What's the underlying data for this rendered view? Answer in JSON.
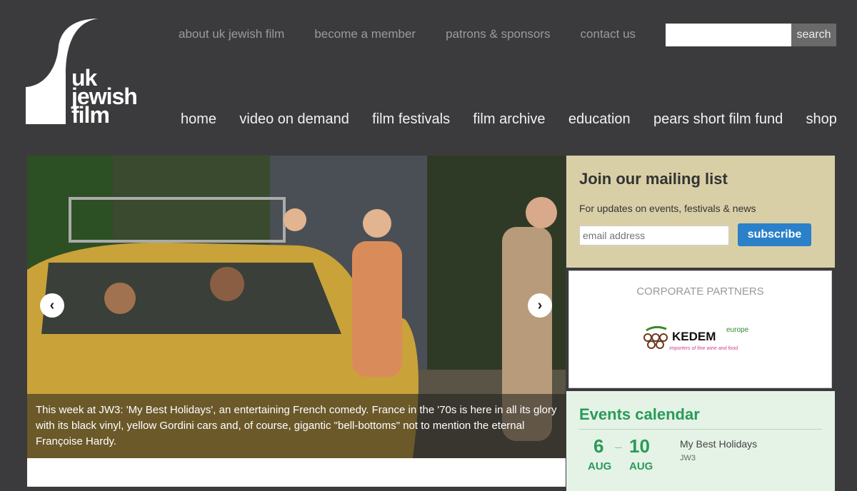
{
  "logo": {
    "line1": "uk",
    "line2": "jewish",
    "line3": "film"
  },
  "topnav": [
    "about uk jewish film",
    "become a member",
    "patrons & sponsors",
    "contact us"
  ],
  "search": {
    "button": "search",
    "placeholder": ""
  },
  "mainnav": [
    "home",
    "video on demand",
    "film festivals",
    "film archive",
    "education",
    "pears short film fund",
    "shop"
  ],
  "hero": {
    "prev": "‹",
    "next": "›",
    "caption": "This week at JW3: 'My Best Holidays', an entertaining French comedy. France in the '70s is here in all its glory with its black vinyl, yellow Gordini cars and, of course, gigantic \"bell-bottoms\" not to mention the eternal Françoise Hardy."
  },
  "mailing": {
    "title": "Join our mailing list",
    "subtitle": "For updates on events, festivals & news",
    "email_placeholder": "email address",
    "subscribe": "subscribe"
  },
  "partners": {
    "heading": "CORPORATE PARTNERS",
    "logo_name": "KEDEM",
    "logo_suffix": "europe",
    "logo_tagline": "Importers of fine wine and food"
  },
  "events": {
    "title": "Events calendar",
    "start_day": "6",
    "start_month": "AUG",
    "end_day": "10",
    "end_month": "AUG",
    "name": "My Best Holidays",
    "venue": "JW3"
  },
  "colors": {
    "background": "#3b3b3d",
    "accent_blue": "#2a80c9",
    "event_green": "#2a9a5a",
    "mailing_bg": "#d9cfa7"
  }
}
